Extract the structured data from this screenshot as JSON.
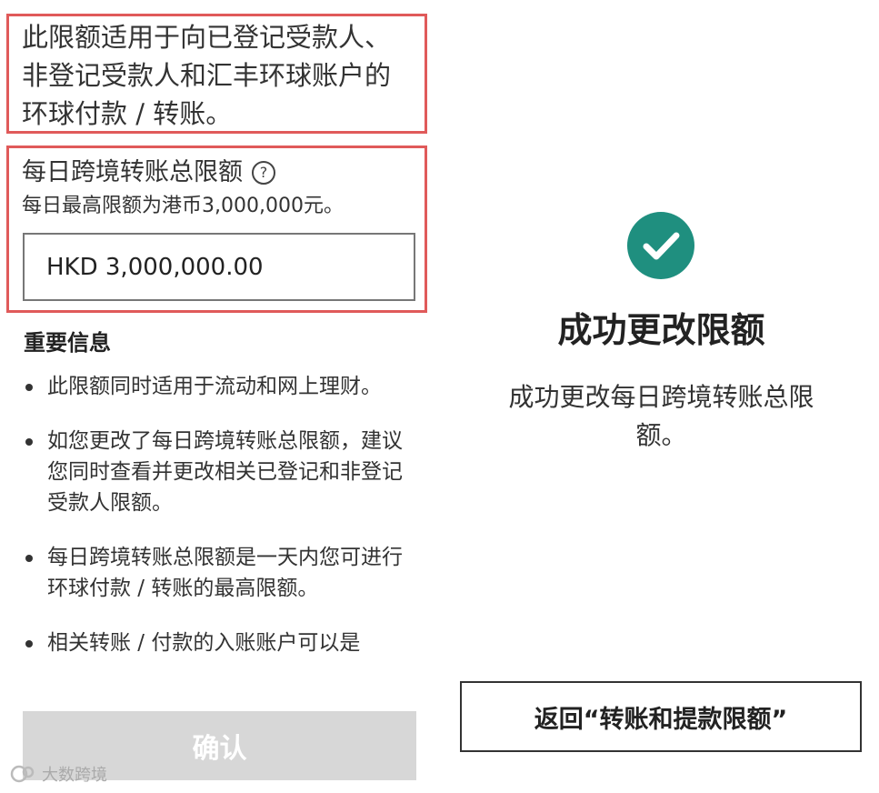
{
  "left_panel": {
    "scope_note": "此限额适用于向已登记受款人、非登记受款人和汇丰环球账户的环球付款 / 转账。",
    "daily_limit": {
      "title": "每日跨境转账总限额",
      "help_icon": "question-circle-icon",
      "subtitle": "每日最高限额为港币3,000,000元。",
      "input_value": "HKD 3,000,000.00"
    },
    "important_info": {
      "title": "重要信息",
      "items": [
        "此限额同时适用于流动和网上理财。",
        "如您更改了每日跨境转账总限额，建议您同时查看并更改相关已登记和非登记受款人限额。",
        "每日跨境转账总限额是一天内您可进行环球付款 / 转账的最高限额。",
        "相关转账 / 付款的入账账户可以是"
      ]
    },
    "confirm_button": "确认",
    "watermark": "大数跨境"
  },
  "right_panel": {
    "status_icon": "check-circle-icon",
    "success_title": "成功更改限额",
    "success_message": "成功更改每日跨境转账总限额。",
    "back_button": "返回“转账和提款限额”"
  },
  "colors": {
    "highlight_border": "#e05a5a",
    "success_green": "#1f8f7f",
    "disabled_button": "#d7d7d7"
  }
}
